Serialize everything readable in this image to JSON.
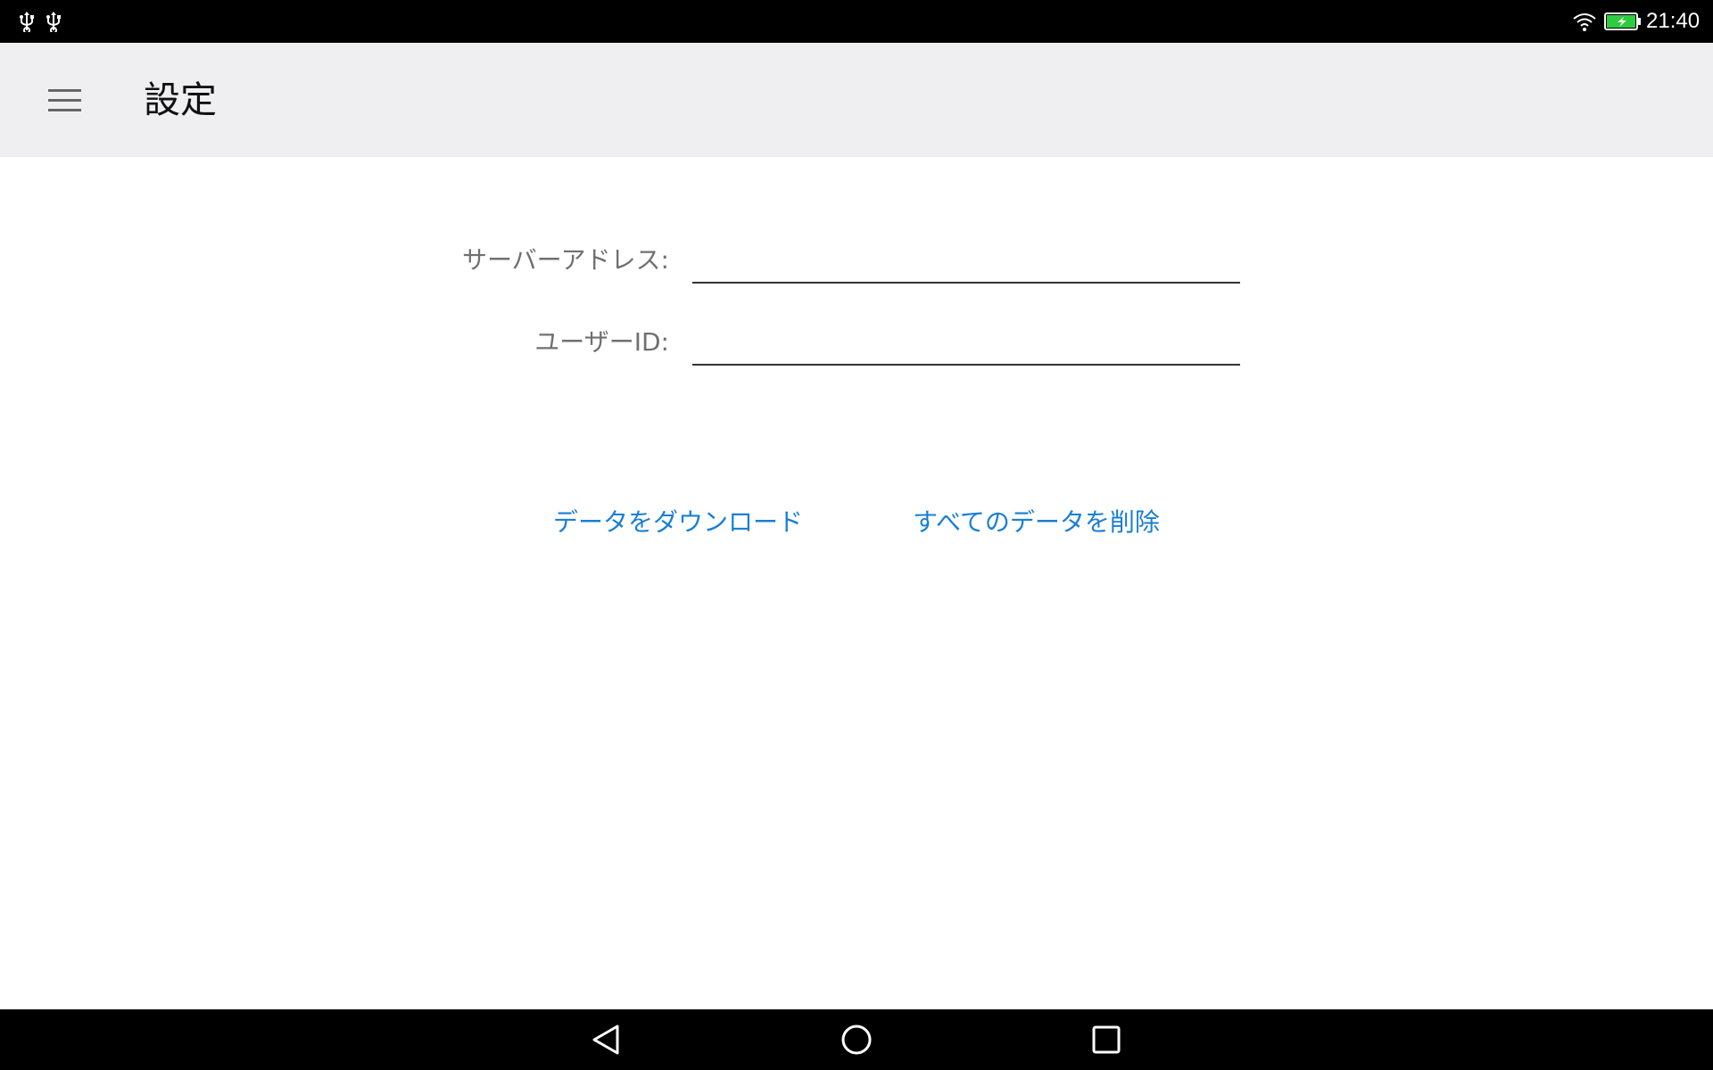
{
  "status_bar": {
    "time": "21:40",
    "icons": [
      "usb-icon",
      "usb-icon",
      "wifi-icon",
      "battery-charging-icon"
    ],
    "battery_color": "#2ecc40"
  },
  "app_bar": {
    "title": "設定",
    "menu_icon": "hamburger-menu-icon"
  },
  "form": {
    "server_address": {
      "label": "サーバーアドレス:",
      "value": ""
    },
    "user_id": {
      "label": "ユーザーID:",
      "value": ""
    }
  },
  "actions": {
    "download_label": "データをダウンロード",
    "delete_all_label": "すべてのデータを削除",
    "accent_color": "#1a7fd4"
  },
  "nav_bar": {
    "icons": [
      "back-icon",
      "home-icon",
      "recent-apps-icon"
    ]
  }
}
